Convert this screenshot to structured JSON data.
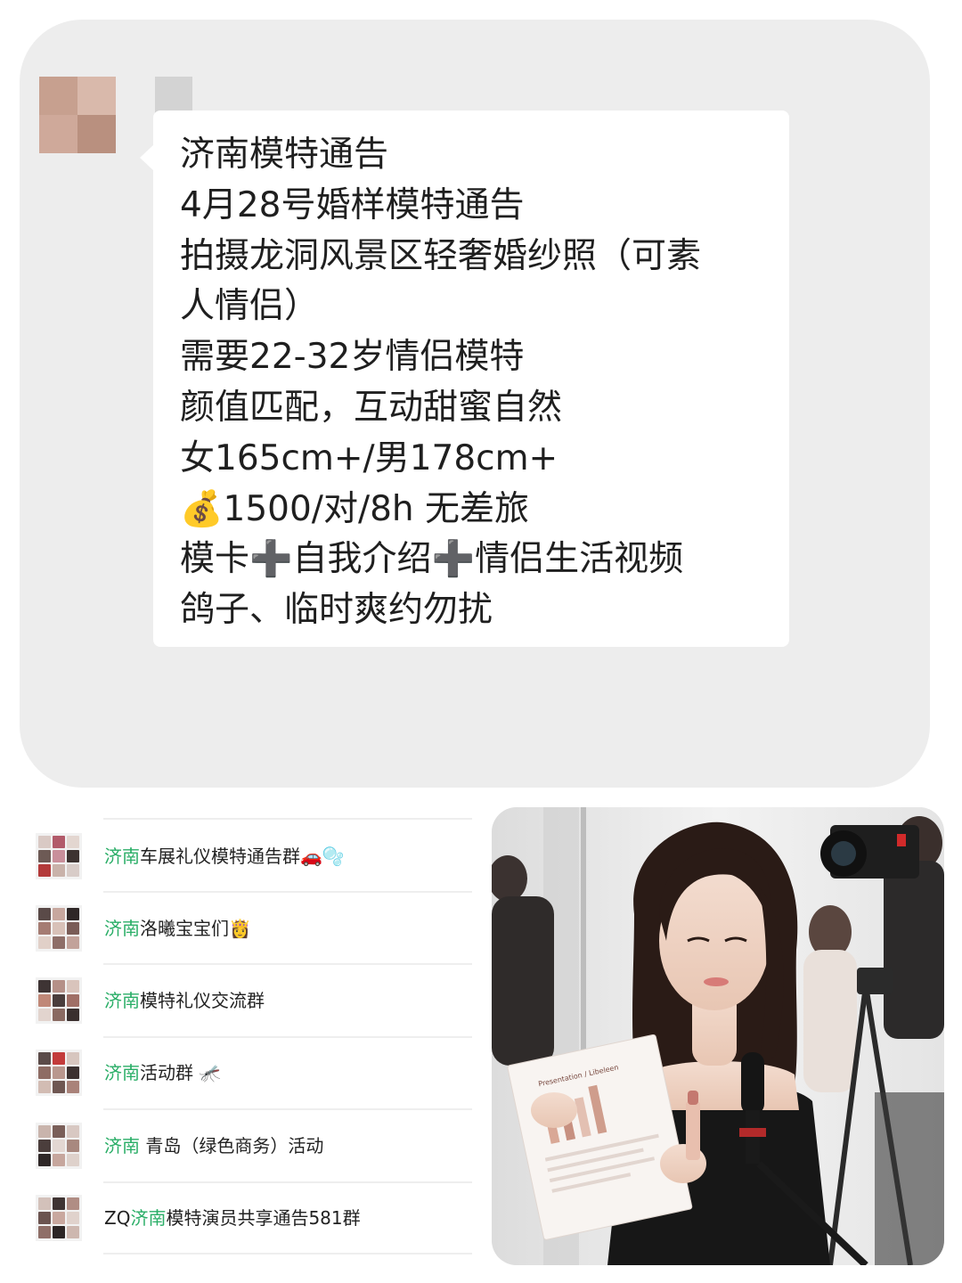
{
  "chat": {
    "message_lines": [
      "济南模特通告",
      "4月28号婚样模特通告",
      "拍摄龙洞风景区轻奢婚纱照（可素",
      "人情侣）",
      "需要22-32岁情侣模特",
      "颜值匹配，互动甜蜜自然",
      "女165cm+/男178cm+",
      "💰1500/对/8h 无差旅",
      "模卡➕自我介绍➕情侣生活视频",
      "鸽子、临时爽约勿扰"
    ]
  },
  "groups": [
    {
      "highlight": "济南",
      "rest": "车展礼仪模特通告群🚗🫧"
    },
    {
      "highlight": "济南",
      "rest": "洛曦宝宝们👸"
    },
    {
      "highlight": "济南",
      "rest": "模特礼仪交流群"
    },
    {
      "highlight": "济南",
      "rest": "活动群 🦟"
    },
    {
      "highlight": "济南",
      "rest": " 青岛（绿色商务）活动"
    },
    {
      "prefix": "ZQ",
      "highlight": "济南",
      "rest": "模特演员共享通告581群"
    }
  ],
  "photo": {
    "flyer_heading": "Presentation / Libeleen"
  },
  "colors": {
    "card_bg": "#ededed",
    "bubble_bg": "#ffffff",
    "group_highlight": "#2aae67"
  }
}
